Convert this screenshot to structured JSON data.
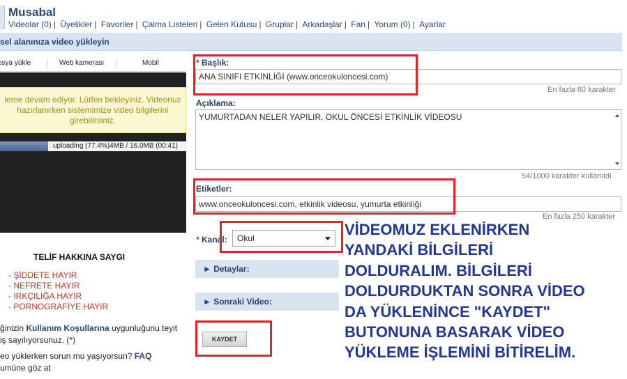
{
  "header": {
    "username": "Musabal",
    "nav": [
      "Videolar (0)",
      "Üyelikler",
      "Favoriler",
      "Çalma Listeleri",
      "Gelen Kutusu",
      "Gruplar",
      "Arkadaşlar",
      "Fan",
      "Yorum (0)",
      "Ayarlar"
    ],
    "separator": "|"
  },
  "upload_banner": "sel alanınıza video yükleyin",
  "tabs": [
    "osya yükle",
    "Web kamerası",
    "Mobil"
  ],
  "notice": [
    "leme devam ediyor. Lütfen bekleyiniz. Videonuz",
    "hazırlanırken sistemimize video bilgilerini",
    "girebilirsiniz."
  ],
  "progress": {
    "text": "uploading (77.4%",
    "text2": ")4MB / 16.0MB (00:41)",
    "fraction": 0.26
  },
  "copyright": {
    "title": "TELİF HAKKINA SAYGI",
    "rules": [
      "- ŞİDDETE HAYIR",
      "- NEFRETE HAYIR",
      "- IRKÇILIĞA HAYIR",
      "- PORNOGRAFİYE HAYIR"
    ]
  },
  "terms": {
    "pre": "ğinizin ",
    "link": "Kullanım Koşullarına",
    "post": " uygunluğunu teyit",
    "line2": "iş sayılıyorsunuz. (*)"
  },
  "faq": {
    "text": "eo yüklerken sorun mu yaşıyorsun? ",
    "link": "FAQ",
    "line2": "umüne göz at"
  },
  "form": {
    "title_label": "Başlık:",
    "title_value": "ANA SINIFI ETKİNLİĞİ (www.onceokuloncesi.com)",
    "title_hint": "En fazla 60 karakter",
    "desc_label": "Açıklama:",
    "desc_value": "YUMURTADAN NELER YAPILIR. OKUL ÖNCESİ ETKİNLİK VİDEOSU",
    "desc_hint": "54/1000 karakter kullanıldı",
    "tags_label": "Etiketler:",
    "tags_value": "www.onceokuloncesi.com, etkinlik videosu, yumurta etkinliği",
    "tags_hint": "En fazla 250 karakter",
    "channel_label": "Kanal:",
    "channel_value": "Okul",
    "required_mark": "*",
    "details": "► Detaylar:",
    "next_video": "► Sonraki Video:",
    "save": "KAYDET"
  },
  "overlay_lines": [
    "VİDEOMUZ EKLENİRKEN",
    "YANDAKİ BİLGİLERİ",
    "DOLDURALIM. BİLGİLERİ",
    "DOLDURDUKTAN SONRA  VİDEO",
    "DA YÜKLENİNCE \"KAYDET\"",
    "BUTONUNA BASARAK VİDEO",
    "YÜKLEME İŞLEMİNİ BİTİRELİM."
  ],
  "colors": {
    "accent": "#2a4a78",
    "annotation_red": "#e0242a",
    "overlay_text": "#233793"
  }
}
